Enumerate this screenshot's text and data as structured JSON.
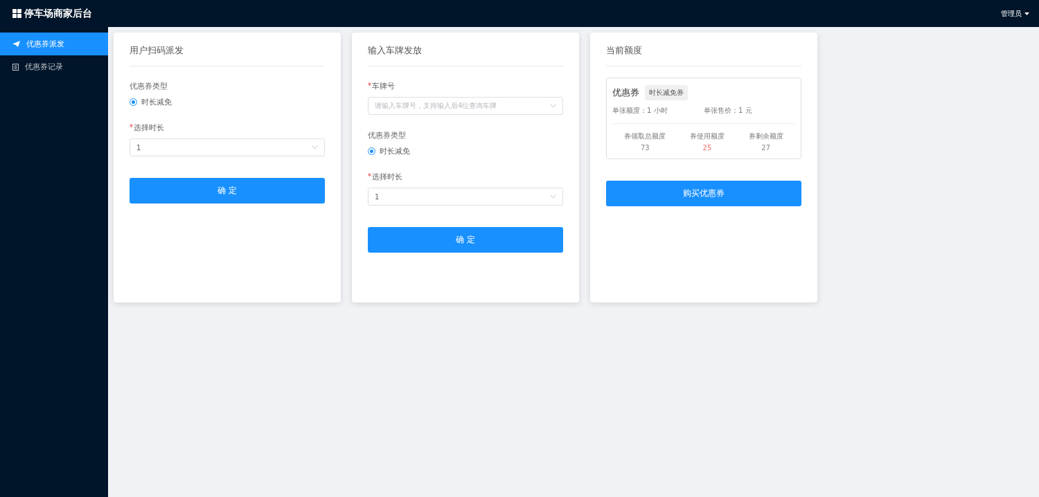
{
  "header": {
    "title": "停车场商家后台",
    "user": "管理员"
  },
  "sidebar": {
    "items": [
      {
        "label": "优惠券派发",
        "kind": "send",
        "selected": true
      },
      {
        "label": "优惠券记录",
        "kind": "record",
        "selected": false
      }
    ]
  },
  "cards": [
    {
      "kind": "form",
      "title": "用户扫码派发",
      "fields": [
        {
          "kind": "radio",
          "label": "优惠券类型",
          "required": false,
          "options": [
            {
              "label": "时长减免",
              "selected": true
            }
          ]
        },
        {
          "kind": "select",
          "label": "选择时长",
          "required": true,
          "value": "1"
        }
      ],
      "button": "确 定"
    },
    {
      "kind": "form",
      "title": "输入车牌发放",
      "fields": [
        {
          "kind": "select",
          "label": "车牌号",
          "required": true,
          "placeholder": "请输入车牌号，支持输入后4位查询车牌"
        },
        {
          "kind": "radio",
          "label": "优惠券类型",
          "required": false,
          "options": [
            {
              "label": "时长减免",
              "selected": true
            }
          ]
        },
        {
          "kind": "select",
          "label": "选择时长",
          "required": true,
          "value": "1"
        }
      ],
      "button": "确 定"
    },
    {
      "kind": "quota",
      "title": "当前额度",
      "coupon": {
        "name": "优惠券",
        "tag": "时长减免券",
        "details": [
          "单张额度：1 小时",
          "单张售价：1 元"
        ],
        "stats": [
          {
            "label": "券领取总额度",
            "value": "73",
            "color": "#888888"
          },
          {
            "label": "券使用额度",
            "value": "25",
            "color": "#f56c6c"
          },
          {
            "label": "券剩余额度",
            "value": "27",
            "color": "#888888"
          }
        ]
      },
      "button": "购买优惠券"
    }
  ]
}
